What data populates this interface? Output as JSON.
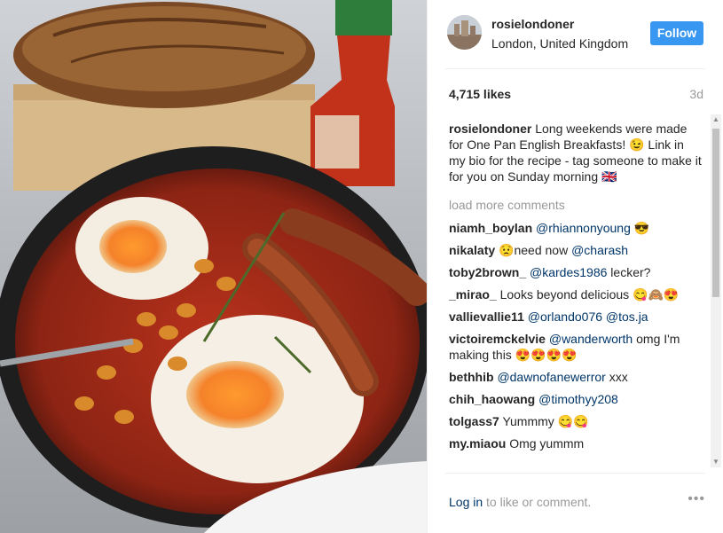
{
  "header": {
    "username": "rosielondoner",
    "location": "London, United Kingdom",
    "follow_label": "Follow"
  },
  "stats": {
    "likes": "4,715 likes",
    "age": "3d"
  },
  "caption": {
    "username": "rosielondoner",
    "text": "Long weekends were made for One Pan English Breakfasts! 😉 Link in my bio for the recipe - tag someone to make it for you on Sunday morning 🇬🇧"
  },
  "load_more": "load more comments",
  "comments": [
    {
      "user": "niamh_boylan",
      "mention": "@rhiannonyoung",
      "text": "😎"
    },
    {
      "user": "nikalaty",
      "mention": "@charash",
      "text": "😟need now",
      "mention_after": true
    },
    {
      "user": "toby2brown_",
      "mention": "@kardes1986",
      "text": "lecker?"
    },
    {
      "user": "_mirao_",
      "mention": "",
      "text": "Looks beyond delicious 😋🙈😍"
    },
    {
      "user": "vallievallie11",
      "mention": "@orlando076 @tos.ja",
      "text": ""
    },
    {
      "user": "victoiremckelvie",
      "mention": "@wanderworth",
      "text": "omg I'm making this 😍😍😍😍"
    },
    {
      "user": "bethhib",
      "mention": "@dawnofanewerror",
      "text": "xxx"
    },
    {
      "user": "chih_haowang",
      "mention": "@timothyy208",
      "text": ""
    },
    {
      "user": "tolgass7",
      "mention": "",
      "text": "Yummmy 😋😋"
    },
    {
      "user": "my.miaou",
      "mention": "",
      "text": "Omg yummm"
    }
  ],
  "footer": {
    "login_link": "Log in",
    "login_rest": "to like or comment.",
    "more_icon": "•••"
  },
  "icons": {
    "more": "more-options-icon",
    "scroll_up": "scroll-up-icon",
    "scroll_down": "scroll-down-icon"
  },
  "colors": {
    "follow": "#3897f0",
    "mention": "#003569",
    "muted": "#999999"
  }
}
